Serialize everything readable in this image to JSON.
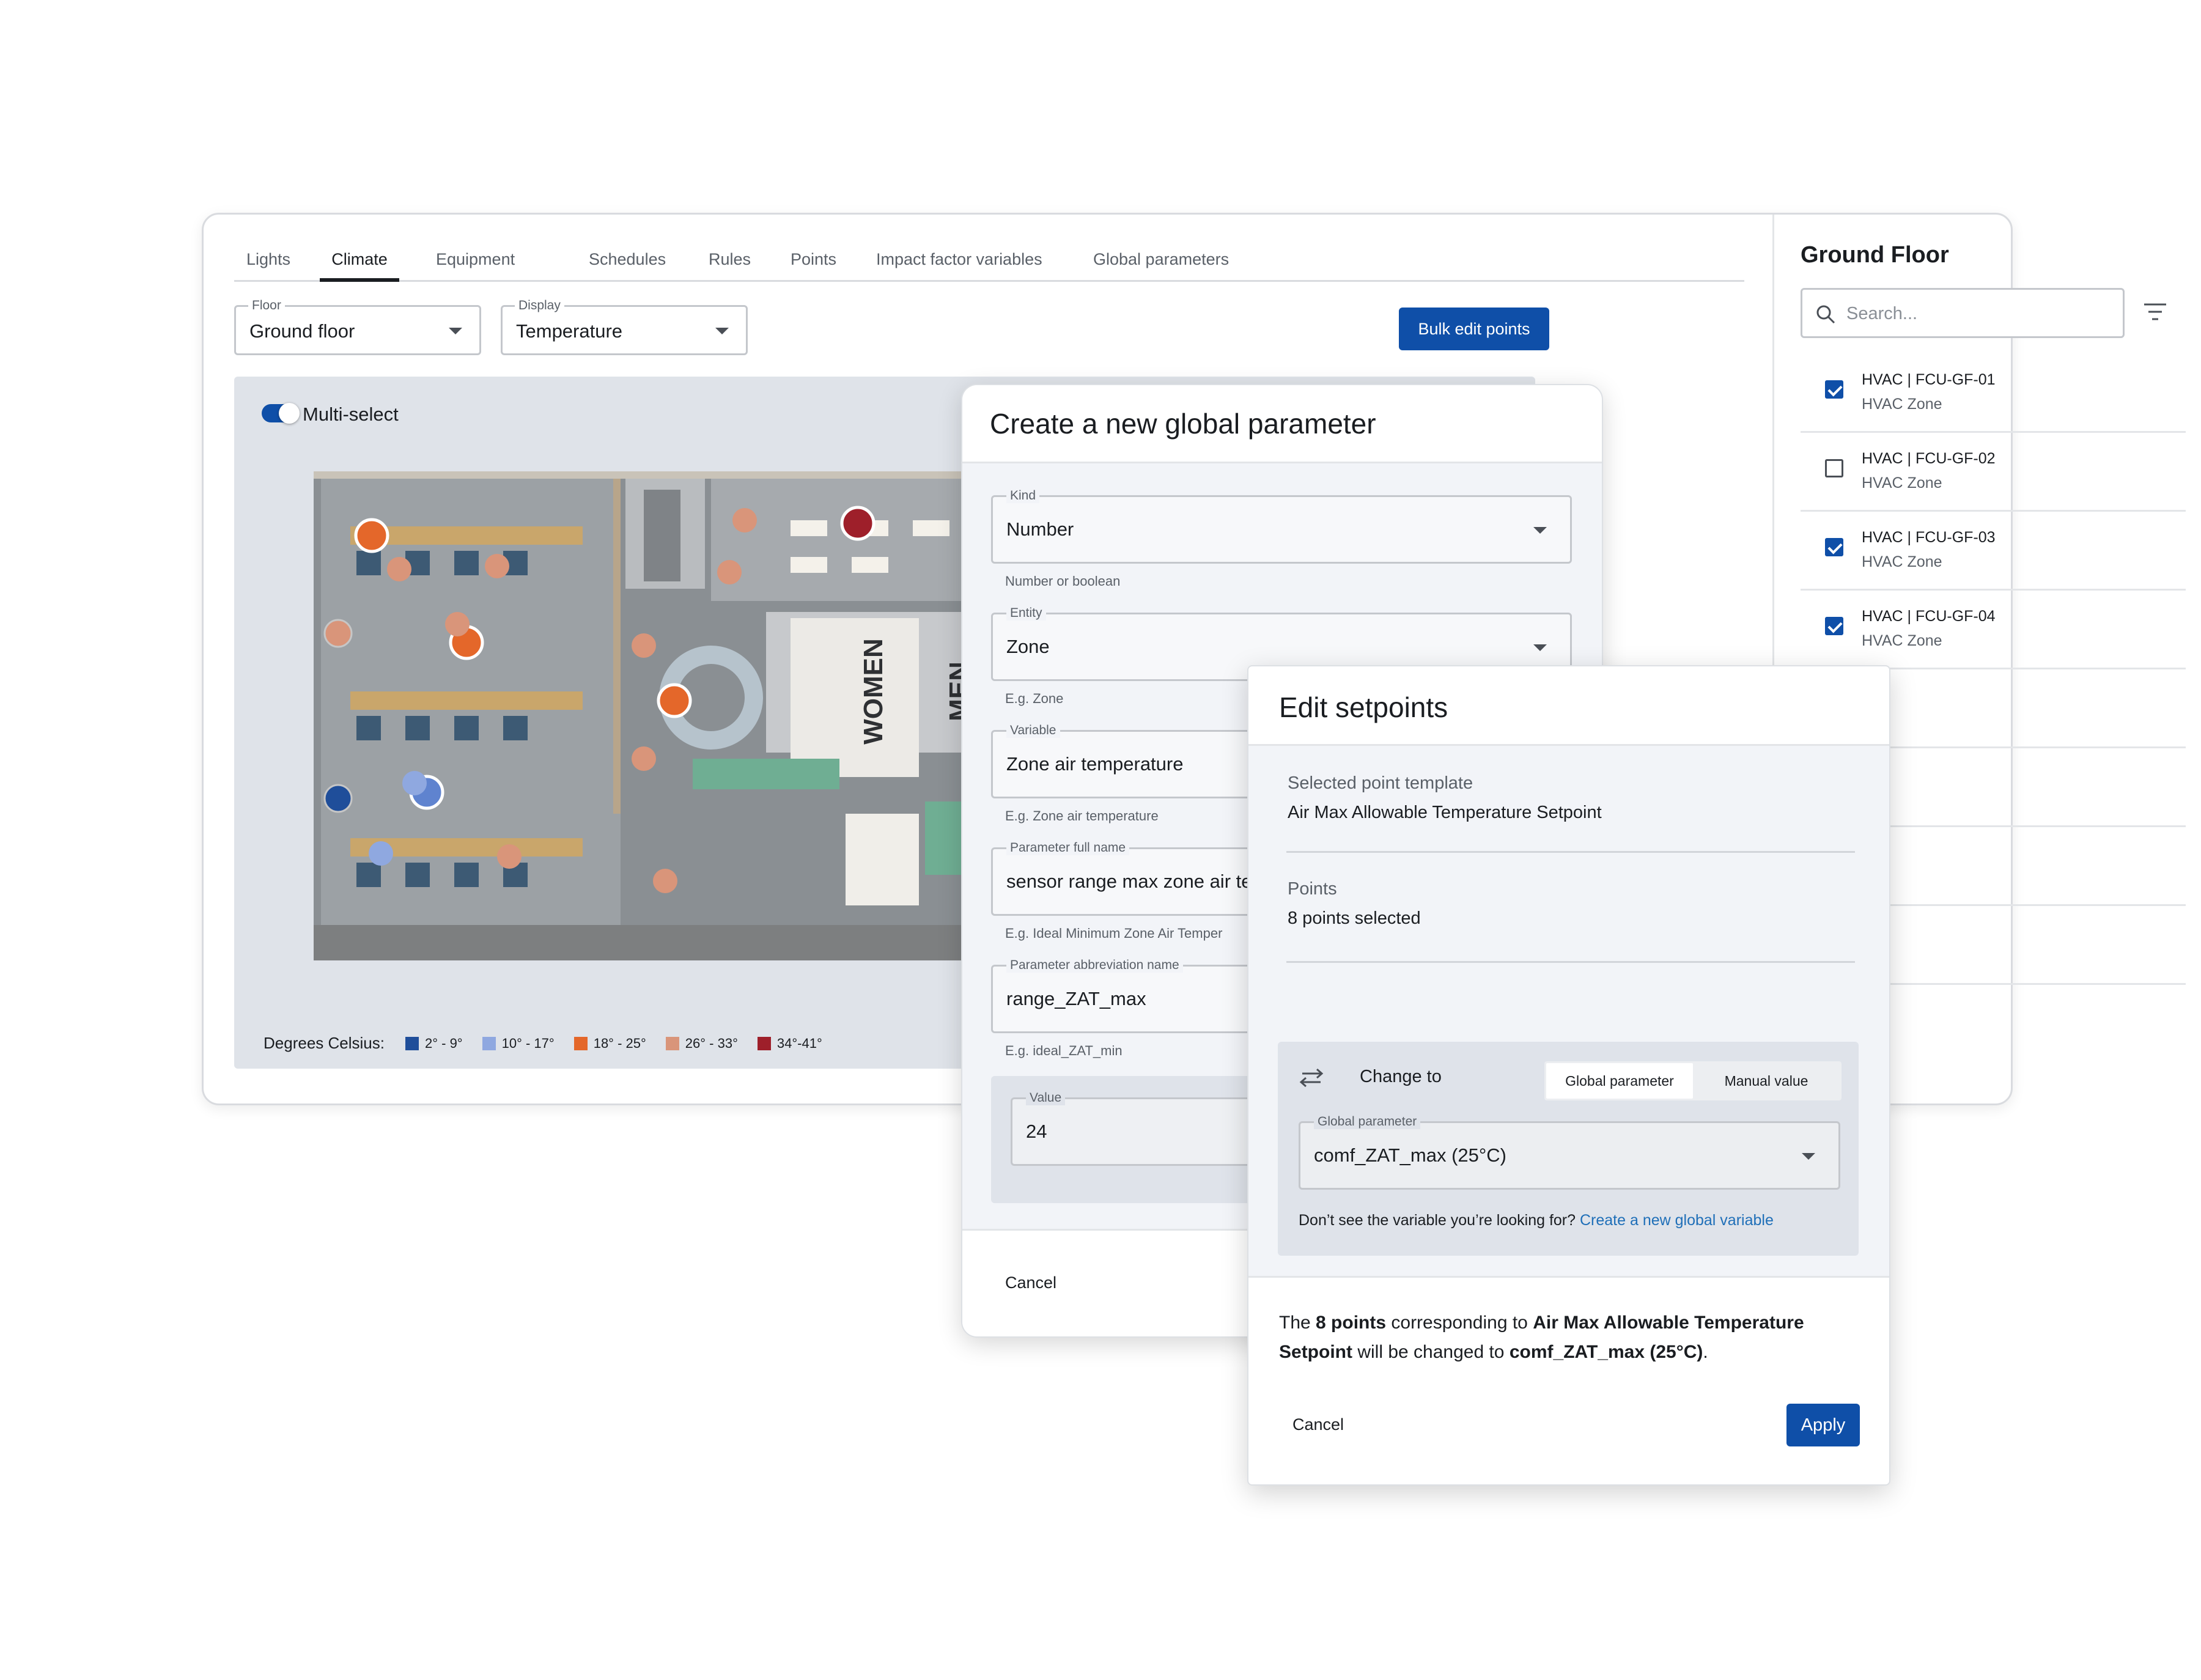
{
  "tabs": [
    "Lights",
    "Climate",
    "Equipment",
    "Schedules",
    "Rules",
    "Points",
    "Impact factor variables",
    "Global parameters"
  ],
  "active_tab": "Climate",
  "floor_select": {
    "label": "Floor",
    "value": "Ground floor"
  },
  "display_select": {
    "label": "Display",
    "value": "Temperature"
  },
  "bulk_edit_label": "Bulk edit points",
  "multi_select": {
    "label": "Multi-select",
    "on": true
  },
  "floorplan": {
    "labels": [
      "WOMEN",
      "MEN"
    ]
  },
  "legend": {
    "title": "Degrees Celsius:",
    "items": [
      {
        "label": "2° - 9°",
        "color": "#1f4e9a"
      },
      {
        "label": "10° - 17°",
        "color": "#8fa8e0"
      },
      {
        "label": "18° - 25°",
        "color": "#e4672a"
      },
      {
        "label": "26° - 33°",
        "color": "#d9957a"
      },
      {
        "label": "34°-41°",
        "color": "#9e1f2a"
      }
    ]
  },
  "side_panel": {
    "title": "Ground Floor",
    "search_placeholder": "Search...",
    "items": [
      {
        "name": "HVAC | FCU-GF-01",
        "type": "HVAC Zone",
        "checked": true
      },
      {
        "name": "HVAC | FCU-GF-02",
        "type": "HVAC Zone",
        "checked": false
      },
      {
        "name": "HVAC | FCU-GF-03",
        "type": "HVAC Zone",
        "checked": true
      },
      {
        "name": "HVAC | FCU-GF-04",
        "type": "HVAC Zone",
        "checked": true
      }
    ]
  },
  "create_dialog": {
    "title": "Create a new global parameter",
    "kind": {
      "label": "Kind",
      "value": "Number",
      "helper": "Number or boolean"
    },
    "entity": {
      "label": "Entity",
      "value": "Zone",
      "helper": "E.g. Zone"
    },
    "variable": {
      "label": "Variable",
      "value": "Zone air temperature",
      "helper": "E.g. Zone air temperature"
    },
    "full_name": {
      "label": "Parameter full name",
      "value": "sensor range max zone air ter",
      "helper": "E.g. Ideal Minimum Zone Air Temper"
    },
    "abbrev": {
      "label": "Parameter abbreviation name",
      "value": "range_ZAT_max",
      "helper": "E.g. ideal_ZAT_min"
    },
    "value": {
      "label": "Value",
      "value": "24"
    },
    "cancel": "Cancel"
  },
  "edit_dialog": {
    "title": "Edit setpoints",
    "template_label": "Selected point template",
    "template_value": "Air Max Allowable Temperature Setpoint",
    "points_label": "Points",
    "points_value": "8 points selected",
    "change_to": "Change to",
    "segments": [
      "Global parameter",
      "Manual value"
    ],
    "active_segment": "Global parameter",
    "global_param": {
      "label": "Global parameter",
      "value": "comf_ZAT_max (25°C)"
    },
    "hint": "Don’t see the variable you’re looking for?",
    "hint_link": "Create a new global variable",
    "summary": {
      "p1": "The ",
      "count": "8 points",
      "p2": " corresponding to ",
      "template": "Air Max Allowable Temperature Setpoint",
      "p3": " will be changed to ",
      "target": "comf_ZAT_max (25°C)",
      "p4": "."
    },
    "cancel": "Cancel",
    "apply": "Apply"
  }
}
